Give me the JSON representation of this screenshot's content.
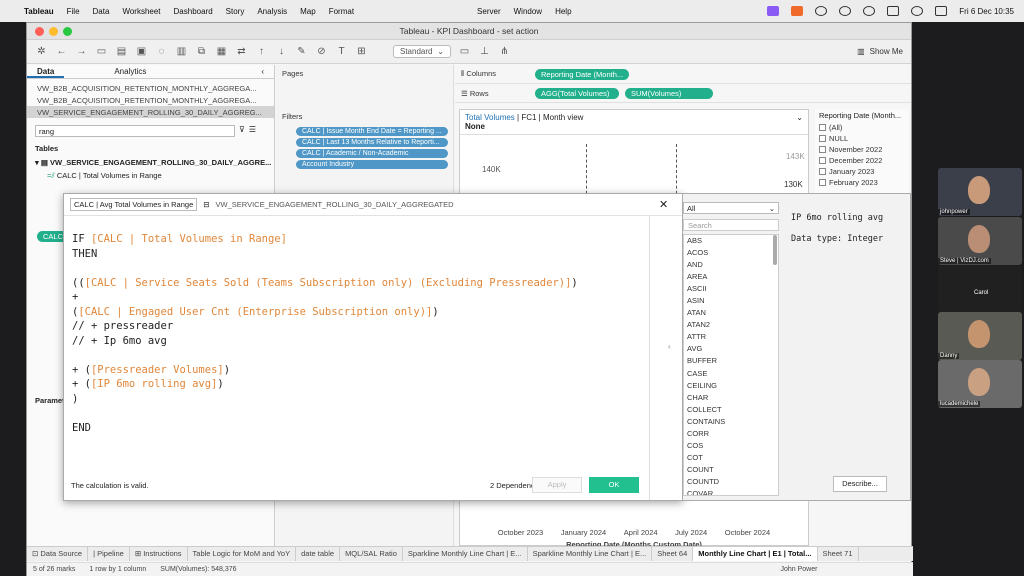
{
  "menubar": {
    "app": "Tableau",
    "items": [
      "File",
      "Data",
      "Worksheet",
      "Dashboard",
      "Story",
      "Analysis",
      "Map",
      "Format",
      "Server",
      "Window",
      "Help"
    ],
    "datetime": "Fri 6 Dec  10:35"
  },
  "window": {
    "title": "Tableau - KPI Dashboard - set action"
  },
  "toolbar": {
    "mark_type": "Standard",
    "show_me": "Show Me"
  },
  "data_panel": {
    "tabs": [
      "Data",
      "Analytics"
    ],
    "datasources": [
      "VW_B2B_ACQUISITION_RETENTION_MONTHLY_AGGREGA...",
      "VW_B2B_ACQUISITION_RETENTION_MONTHLY_AGGREGA...",
      "VW_SERVICE_ENGAGEMENT_ROLLING_30_DAILY_AGGREG..."
    ],
    "search_value": "rang",
    "tables_label": "Tables",
    "table_name": "VW_SERVICE_ENGAGEMENT_ROLLING_30_DAILY_AGGRE...",
    "field": "CALC | Total Volumes in Range",
    "calc_pill": "CALC | Avg",
    "parameters_label": "Parameters"
  },
  "pages_label": "Pages",
  "filters": {
    "label": "Filters",
    "items": [
      "CALC | Issue Month End Date = Reporting ...",
      "CALC | Last 13 Months Relative to Reporti...",
      "CALC | Academic / Non-Academic",
      "Account Industry"
    ]
  },
  "shelves": {
    "columns_label": "Columns",
    "columns": [
      "Reporting Date (Month..."
    ],
    "rows_label": "Rows",
    "rows": [
      "AGG(Total Volumes)",
      "SUM(Volumes)"
    ]
  },
  "viz": {
    "title_part1": "Total Volumes",
    "title_part2": " | FC1 | Month view",
    "subtitle": "None",
    "y_tick": "140K",
    "label_a": "143K",
    "label_b": "130K",
    "x_ticks": [
      "October 2023",
      "January 2024",
      "April 2024",
      "July 2024",
      "October 2024"
    ],
    "x_title": "Reporting Date (Months Custom Date)"
  },
  "legend": {
    "title": "Reporting Date (Month...",
    "items": [
      "(All)",
      "NULL",
      "November 2022",
      "December 2022",
      "January 2023",
      "February 2023"
    ]
  },
  "calc_editor": {
    "name": "CALC | Avg Total Volumes in Range",
    "source": "VW_SERVICE_ENGAGEMENT_ROLLING_30_DAILY_AGGREGATED",
    "code": [
      {
        "t": "IF ",
        "f": "[CALC | Total Volumes in Range]"
      },
      {
        "t": "THEN",
        "f": ""
      },
      {
        "t": "",
        "f": ""
      },
      {
        "t": "((",
        "f": "[CALC | Service Seats Sold (Teams Subscription only) (Excluding Pressreader)]",
        "e": ")"
      },
      {
        "t": "+",
        "f": ""
      },
      {
        "t": "(",
        "f": "[CALC | Engaged User Cnt (Enterprise Subscription only)]",
        "e": ")"
      },
      {
        "t": "// + pressreader",
        "f": ""
      },
      {
        "t": "// + Ip 6mo avg",
        "f": ""
      },
      {
        "t": "",
        "f": ""
      },
      {
        "t": "+ (",
        "f": "[Pressreader Volumes]",
        "e": ")"
      },
      {
        "t": "+ (",
        "f": "[IP 6mo rolling avg]",
        "e": ")"
      },
      {
        "t": ")",
        "f": ""
      },
      {
        "t": "",
        "f": ""
      },
      {
        "t": "END",
        "f": ""
      }
    ],
    "status": "The calculation is valid.",
    "dependencies": "2 Dependencies",
    "apply": "Apply",
    "ok": "OK"
  },
  "functions": {
    "filter": "All",
    "search_placeholder": "Search",
    "list": [
      "ABS",
      "ACOS",
      "AND",
      "AREA",
      "ASCII",
      "ASIN",
      "ATAN",
      "ATAN2",
      "ATTR",
      "AVG",
      "BUFFER",
      "CASE",
      "CEILING",
      "CHAR",
      "COLLECT",
      "CONTAINS",
      "CORR",
      "COS",
      "COT",
      "COUNT",
      "COUNTD",
      "COVAR"
    ],
    "selected_name": "IP 6mo rolling avg",
    "data_type": "Data type: Integer",
    "describe": "Describe..."
  },
  "sheet_tabs": [
    "Data Source",
    "Pipeline",
    "Instructions",
    "Table Logic for MoM and YoY",
    "date table",
    "MQL/SAL Ratio",
    "Sparkline Monthly Line Chart | E...",
    "Sparkline Monthly Line Chart | E...",
    "Sheet 64",
    "Monthly Line Chart | E1 | Total...",
    "Sheet 71"
  ],
  "status": {
    "marks": "5 of 26 marks",
    "rows": "1 row by 1 column",
    "sum": "SUM(Volumes): 548,376",
    "user": "John Power"
  },
  "participants": [
    "johnpower",
    "Steve | VizDJ.com",
    "Carol",
    "Danny",
    "lucademichele"
  ]
}
